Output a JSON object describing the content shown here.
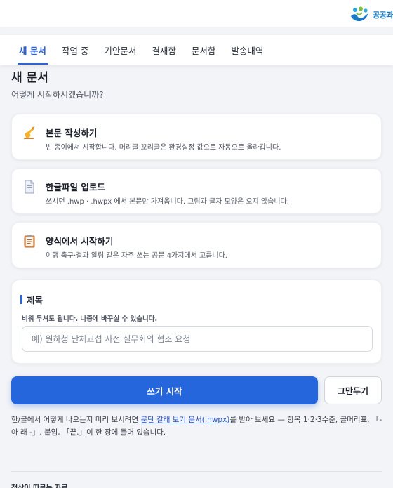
{
  "brand": {
    "logo_text": "공공과"
  },
  "tabs": [
    {
      "label": "새 문서",
      "active": true
    },
    {
      "label": "작업 중"
    },
    {
      "label": "기안문서"
    },
    {
      "label": "결재함"
    },
    {
      "label": "문서함"
    },
    {
      "label": "발송내역"
    }
  ],
  "page": {
    "title": "새 문서",
    "subtitle": "어떻게 시작하시겠습니까?"
  },
  "options": [
    {
      "icon": "writing-hand-icon",
      "title": "본문 작성하기",
      "desc": "빈 종이에서 시작합니다. 머리글·꼬리글은 환경설정 값으로 자동으로 올라갑니다."
    },
    {
      "icon": "document-icon",
      "title": "한글파일 업로드",
      "desc": "쓰시던 .hwp · .hwpx 에서 본문만 가져옵니다. 그림과 글자 모양은 오지 않습니다."
    },
    {
      "icon": "clipboard-icon",
      "title": "양식에서 시작하기",
      "desc": "이행 촉구·결과 알림 같은 자주 쓰는 공문 4가지에서 고릅니다."
    }
  ],
  "title_section": {
    "label": "제목",
    "hint": "비워 두셔도 됩니다. 나중에 바꾸실 수 있습니다.",
    "input_value": "",
    "placeholder": "예) 원하청 단체교섭 사전 실무회의 협조 요청"
  },
  "actions": {
    "primary": "쓰기 시작",
    "secondary": "그만두기"
  },
  "helper": {
    "before": "한/글에서 어떻게 나오는지 미리 보시려면 ",
    "link": "문단 갈래 보기 문서(.hwpx)",
    "after": "를 받아 보세요 — 항목 1·2·3수준, 글머리표, 「- 아 래 -」, 붙임, 「끝.」이 한 장에 들어 있습니다."
  },
  "footer": {
    "label": "첨삭이 따르는 자료"
  },
  "colors": {
    "accent": "#2b63d9",
    "primary_button": "#2566dd",
    "background": "#f3f4f7",
    "link": "#1f4fc7"
  }
}
